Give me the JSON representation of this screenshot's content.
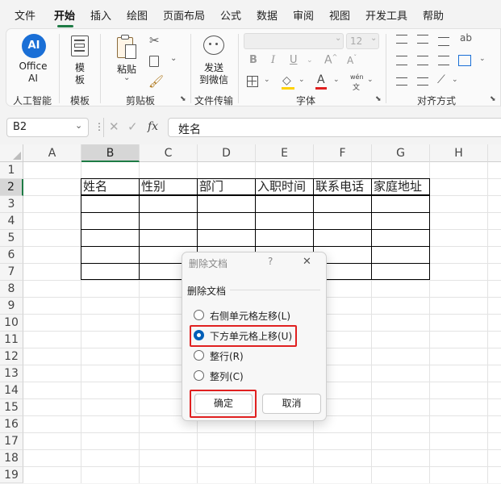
{
  "menu": {
    "items": [
      {
        "label": "文件",
        "active": false
      },
      {
        "label": "开始",
        "active": true
      },
      {
        "label": "插入",
        "active": false
      },
      {
        "label": "绘图",
        "active": false
      },
      {
        "label": "页面布局",
        "active": false
      },
      {
        "label": "公式",
        "active": false
      },
      {
        "label": "数据",
        "active": false
      },
      {
        "label": "审阅",
        "active": false
      },
      {
        "label": "视图",
        "active": false
      },
      {
        "label": "开发工具",
        "active": false
      },
      {
        "label": "帮助",
        "active": false
      }
    ]
  },
  "ribbon": {
    "ai": {
      "icon_text": "AI",
      "label_line1": "Office",
      "label_line2": "AI",
      "group": "人工智能"
    },
    "template": {
      "label_line1": "模",
      "label_line2": "板",
      "group": "模板"
    },
    "clipboard": {
      "paste_label": "粘贴",
      "group": "剪贴板"
    },
    "transfer": {
      "label_line1": "发送",
      "label_line2": "到微信",
      "group": "文件传输"
    },
    "font": {
      "font_size": "12",
      "bold": "B",
      "italic": "I",
      "underline": "U",
      "grow": "A",
      "shrink": "A",
      "font_color": "A",
      "phonetic": "wén",
      "group": "字体"
    },
    "align": {
      "wrap_icon": "ab",
      "group": "对齐方式"
    }
  },
  "formula_bar": {
    "name_box": "B2",
    "fx": "fx",
    "content": "姓名"
  },
  "sheet": {
    "columns": [
      "A",
      "B",
      "C",
      "D",
      "E",
      "F",
      "G",
      "H"
    ],
    "selected_column": "B",
    "rows": [
      "1",
      "2",
      "3",
      "4",
      "5",
      "6",
      "7",
      "8",
      "9",
      "10",
      "11",
      "12",
      "13",
      "14",
      "15",
      "16",
      "17",
      "18",
      "19"
    ],
    "selected_row": "2",
    "table_headers": [
      "姓名",
      "性别",
      "部门",
      "入职时间",
      "联系电话",
      "家庭地址"
    ]
  },
  "dialog": {
    "title": "删除文档",
    "help": "?",
    "close": "✕",
    "section_title": "删除文档",
    "options": [
      {
        "label": "右侧单元格左移(L)",
        "selected": false
      },
      {
        "label": "下方单元格上移(U)",
        "selected": true
      },
      {
        "label": "整行(R)",
        "selected": false
      },
      {
        "label": "整列(C)",
        "selected": false
      }
    ],
    "ok": "确定",
    "cancel": "取消"
  },
  "colors": {
    "accent": "#1e7b45",
    "dialog_accent": "#005fb8",
    "highlight": "#e02020"
  }
}
